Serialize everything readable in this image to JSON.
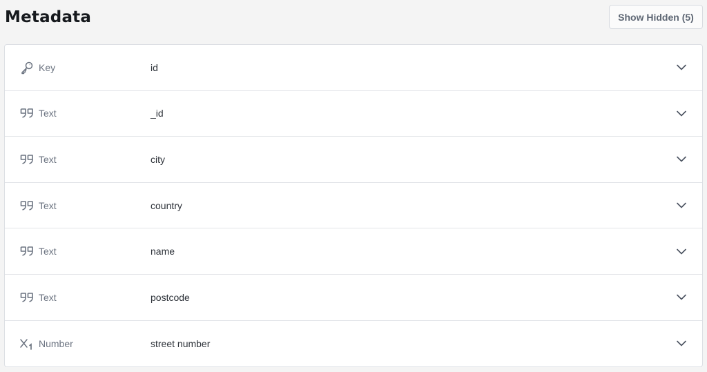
{
  "header": {
    "title": "Metadata",
    "show_hidden_label": "Show Hidden (5)"
  },
  "fields": [
    {
      "icon": "key-icon",
      "type": "Key",
      "name": "id"
    },
    {
      "icon": "quote-icon",
      "type": "Text",
      "name": "_id"
    },
    {
      "icon": "quote-icon",
      "type": "Text",
      "name": "city"
    },
    {
      "icon": "quote-icon",
      "type": "Text",
      "name": "country"
    },
    {
      "icon": "quote-icon",
      "type": "Text",
      "name": "name"
    },
    {
      "icon": "quote-icon",
      "type": "Text",
      "name": "postcode"
    },
    {
      "icon": "number-icon",
      "type": "Number",
      "name": "street number"
    }
  ],
  "colors": {
    "background": "#f4f4f4",
    "card": "#ffffff",
    "muted_text": "#6b7380",
    "text": "#2d3239"
  }
}
